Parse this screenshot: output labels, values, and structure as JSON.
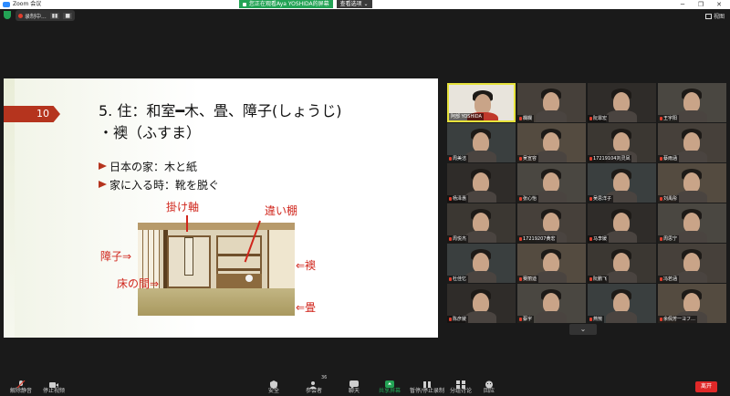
{
  "window": {
    "title": "Zoom 会议",
    "controls": [
      "─",
      "❐",
      "✕"
    ]
  },
  "share_banner": {
    "status": "您正在观看Aya YOSHIDA的屏幕",
    "view_options": "查看选项 ⌄"
  },
  "recording": {
    "label": "录制中...",
    "pause": "▮▮",
    "stop": "■"
  },
  "view_toggle": {
    "label": "视图"
  },
  "slide": {
    "page_number": "10",
    "title_line1": "5.  住：和室━木、畳、障子(しょうじ)",
    "title_line2": "・襖（ふすま）",
    "bullets": [
      "日本の家：木と紙",
      "家に入る時：靴を脱ぐ"
    ],
    "labels": {
      "kakejiku": "掛け軸",
      "chigaidana": "違い棚",
      "shoji": "障子⇒",
      "tokonoma": "床の間⇒",
      "fusuma": "⇐襖",
      "tatami": "⇐畳"
    }
  },
  "participants": [
    {
      "name": "阿部 YOSHIDA",
      "muted": false,
      "active": true
    },
    {
      "name": "欄欄",
      "muted": true
    },
    {
      "name": "阮霏宏",
      "muted": true
    },
    {
      "name": "王宇阳",
      "muted": true
    },
    {
      "name": "周美洁",
      "muted": true
    },
    {
      "name": "吴宣容",
      "muted": true
    },
    {
      "name": "17219104刘灵凤",
      "muted": true
    },
    {
      "name": "蔡雨涵",
      "muted": true
    },
    {
      "name": "杨泽惠",
      "muted": true
    },
    {
      "name": "张心怡",
      "muted": true
    },
    {
      "name": "吴思洋子",
      "muted": true
    },
    {
      "name": "刘禹彤",
      "muted": true
    },
    {
      "name": "周悦杰",
      "muted": true
    },
    {
      "name": "17219207黄宏",
      "muted": true
    },
    {
      "name": "马李媛",
      "muted": true
    },
    {
      "name": "周思宁",
      "muted": true
    },
    {
      "name": "杜佳忆",
      "muted": true
    },
    {
      "name": "赛丽迪",
      "muted": true
    },
    {
      "name": "阮鹏飞",
      "muted": true
    },
    {
      "name": "冯若涵",
      "muted": true
    },
    {
      "name": "陈彦媛",
      "muted": true
    },
    {
      "name": "蔡宇",
      "muted": true
    },
    {
      "name": "燕惋",
      "muted": true
    },
    {
      "name": "余佩芳一ヨフ…",
      "muted": true
    }
  ],
  "toolbar": {
    "unmute": "解除静音",
    "stop_video": "停止视频",
    "security": "安全",
    "participants": "参会者",
    "participants_count": "36",
    "chat": "聊天",
    "share_screen": "共享屏幕",
    "pause_share": "暂停/停止录制",
    "breakout": "分组讨论",
    "reactions": "回应",
    "leave": "离开"
  },
  "colors": {
    "accent_red": "#b5341e",
    "label_red": "#d0261c",
    "share_green": "#23a355",
    "leave_red": "#e02828",
    "active_border": "#e6e23c"
  }
}
